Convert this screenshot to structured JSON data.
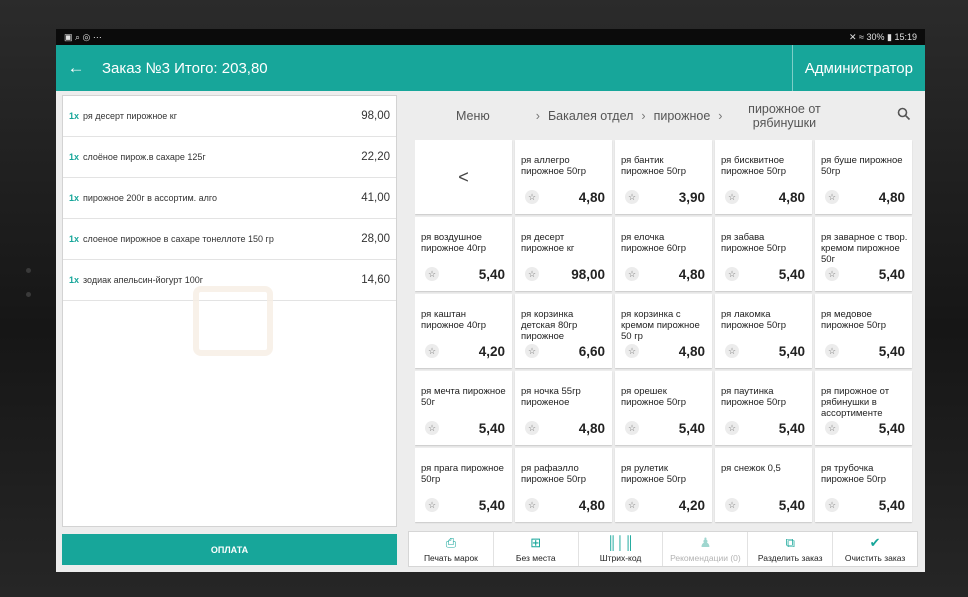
{
  "status_bar": {
    "left_icons": "▣ ⌕ ◎ ⋯",
    "right": "✕ ≈ 30% ▮ 15:19"
  },
  "appbar": {
    "title": "Заказ №3 Итого: 203,80",
    "admin": "Администратор"
  },
  "order_items": [
    {
      "qty": "1x",
      "name": "ря десерт пирожное  кг",
      "price": "98,00"
    },
    {
      "qty": "1x",
      "name": "слоёное пирож.в сахаре 125г",
      "price": "22,20"
    },
    {
      "qty": "1x",
      "name": "пирожное  200г в ассортим. алго",
      "price": "41,00"
    },
    {
      "qty": "1x",
      "name": "слоеное пирожное в сахаре тонеллоте 150 гр",
      "price": "28,00"
    },
    {
      "qty": "1x",
      "name": "зодиак апельсин-йогурт 100г",
      "price": "14,60"
    }
  ],
  "pay_button": "ОПЛАТА",
  "breadcrumbs": [
    "Меню",
    "Бакалея отдел",
    "пирожное",
    "пирожное от рябинушки"
  ],
  "back_tile": "<",
  "products": [
    {
      "name": "ря аллегро пирожное 50гр",
      "price": "4,80"
    },
    {
      "name": "ря бантик пирожное  50гр",
      "price": "3,90"
    },
    {
      "name": "ря бисквитное пирожное  50гр",
      "price": "4,80"
    },
    {
      "name": "ря буше пирожное 50гр",
      "price": "4,80"
    },
    {
      "name": "ря воздушное пирожное 40гр",
      "price": "5,40"
    },
    {
      "name": "ря десерт пирожное  кг",
      "price": "98,00"
    },
    {
      "name": "ря елочка пирожное 60гр",
      "price": "4,80"
    },
    {
      "name": "ря забава пирожное 50гр",
      "price": "5,40"
    },
    {
      "name": "ря заварное с твор. кремом пирожное 50г",
      "price": "5,40"
    },
    {
      "name": "ря каштан пирожное 40гр",
      "price": "4,20"
    },
    {
      "name": "ря корзинка детская 80гр пирожное",
      "price": "6,60"
    },
    {
      "name": "ря корзинка с кремом пирожное 50 гр",
      "price": "4,80"
    },
    {
      "name": "ря лакомка пирожное 50гр",
      "price": "5,40"
    },
    {
      "name": "ря медовое пирожное 50гр",
      "price": "5,40"
    },
    {
      "name": "ря мечта пирожное 50г",
      "price": "5,40"
    },
    {
      "name": "ря ночка 55гр пироженое",
      "price": "4,80"
    },
    {
      "name": "ря орешек пирожное 50гр",
      "price": "5,40"
    },
    {
      "name": "ря паутинка пирожное  50гр",
      "price": "5,40"
    },
    {
      "name": "ря пирожное от рябинушки в ассортименте",
      "price": "5,40"
    },
    {
      "name": "ря прага пирожное 50гр",
      "price": "5,40"
    },
    {
      "name": "ря рафаэлло пирожное 50гр",
      "price": "4,80"
    },
    {
      "name": "ря рулетик пирожное 50гр",
      "price": "4,20"
    },
    {
      "name": "ря снежок 0,5",
      "price": "5,40"
    },
    {
      "name": "ря трубочка пирожное 50гр",
      "price": "5,40"
    }
  ],
  "toolbar": [
    {
      "label": "Печать марок",
      "icon": "printer-icon",
      "glyph": "⎙",
      "disabled": false
    },
    {
      "label": "Без места",
      "icon": "grid-icon",
      "glyph": "⊞",
      "disabled": false
    },
    {
      "label": "Штрих-код",
      "icon": "barcode-icon",
      "glyph": "║│║",
      "disabled": false
    },
    {
      "label": "Рекомендации (0)",
      "icon": "recommend-icon",
      "glyph": "♟",
      "disabled": true
    },
    {
      "label": "Разделить заказ",
      "icon": "split-icon",
      "glyph": "⧉",
      "disabled": false
    },
    {
      "label": "Очистить заказ",
      "icon": "broom-icon",
      "glyph": "✔",
      "disabled": false
    }
  ],
  "colors": {
    "accent": "#17a69a",
    "background": "#ededed"
  }
}
